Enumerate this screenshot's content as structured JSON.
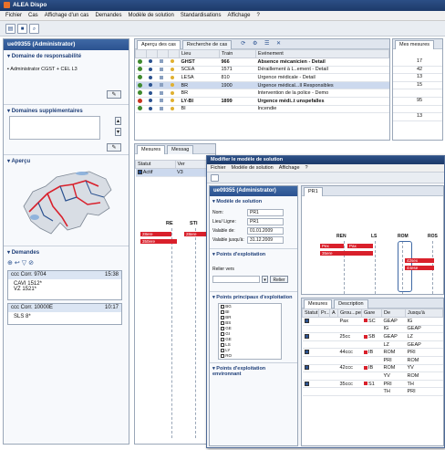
{
  "app": {
    "title": "ALEA Dispo"
  },
  "menu": [
    "Fichier",
    "Cas",
    "Affichage d'un cas",
    "Demandes",
    "Modèle de solution",
    "Standardisations",
    "Affichage",
    "?"
  ],
  "left": {
    "user": "ue09355 (Administrator)",
    "resp_head": "Domaine de responsabilité",
    "resp_item": "Administrator CGST + CEL L3",
    "supp_head": "Domaines supplémentaires",
    "apercu_head": "Aperçu",
    "demandes_head": "Demandes",
    "requests": [
      {
        "code": "ccc",
        "title": "Corr. 9704",
        "time": "15:38",
        "lines": [
          "CAVI 1512*",
          "VZ 1521*"
        ]
      },
      {
        "code": "ccc",
        "title": "Corr. 10000E",
        "time": "10:17",
        "lines": [
          "SLS 8*"
        ]
      }
    ]
  },
  "cases": {
    "tabs": [
      "Aperçu des cas",
      "Recherche de cas"
    ],
    "columns": [
      "",
      "",
      "",
      "",
      "Lieu",
      "Train",
      "Evénement"
    ],
    "rows": [
      {
        "lieu": "GHST",
        "train": "966",
        "event": "Absence mécanicien - Detail",
        "bold": true,
        "sel": false,
        "c": "#3f8a2e"
      },
      {
        "lieu": "SCEA",
        "train": "1571",
        "event": "Déraillement à L..ement - Detail",
        "bold": false,
        "sel": false,
        "c": "#3f8a2e"
      },
      {
        "lieu": "LESA",
        "train": "810",
        "event": "Urgence médicale - Detail",
        "bold": false,
        "sel": false,
        "c": "#3f8a2e"
      },
      {
        "lieu": "BR",
        "train": "1900",
        "event": "Urgence médical...Il Responsibles",
        "bold": false,
        "sel": true,
        "c": "#3f8a2e"
      },
      {
        "lieu": "BR",
        "train": "",
        "event": "Intervention de la police - Demo",
        "bold": false,
        "sel": false,
        "c": "#3f8a2e"
      },
      {
        "lieu": "LY-BI",
        "train": "1899",
        "event": "Urgence médi..t unspefalles",
        "bold": true,
        "sel": false,
        "c": "#c8341f"
      },
      {
        "lieu": "BI",
        "train": "",
        "event": "Incendie",
        "bold": false,
        "sel": false,
        "c": "#3f8a2e"
      }
    ]
  },
  "measures_right": {
    "tab": "Mes mesures",
    "rows": [
      "17",
      "42",
      "13",
      "15",
      "",
      "95",
      "",
      "13"
    ]
  },
  "lower_left": {
    "tabs": [
      "Mesures",
      "Messag"
    ],
    "columns": [
      "Statut",
      "Ver"
    ],
    "row": {
      "status": "Actif",
      "ver": "V3"
    },
    "labels": [
      "RE",
      "STI"
    ],
    "bars": [
      "28ere",
      "28ere",
      "350ere"
    ]
  },
  "modal": {
    "title": "Modifier le modèle de solution",
    "menu": [
      "Fichier",
      "Modèle de solution",
      "Affichage",
      "?"
    ],
    "user": "ue09355 (Administrator)",
    "model_head": "Modèle de solution",
    "fields": [
      {
        "label": "Nom:",
        "value": "PR1"
      },
      {
        "label": "Lieu/ Ligne:",
        "value": "PR1"
      },
      {
        "label": "Valable de:",
        "value": "01.01.2009"
      },
      {
        "label": "Valable jusqu'à:",
        "value": "31.12.2009"
      }
    ],
    "points_head": "Points d'exploitation",
    "relier_label": "Relier vers",
    "select_value": "",
    "relier_btn": "Relier",
    "principal_head": "Points principaux d'exploitation",
    "principal_items": [
      "BG",
      "BI",
      "BR",
      "BS",
      "GE",
      "GI",
      "GE",
      "LS",
      "LY",
      "RO"
    ],
    "env_head": "Points d'exploitation environnant",
    "diagram_tab": "PR1",
    "diagram_labels": [
      "REN",
      "LS",
      "ROM",
      "ROS"
    ],
    "diagram_bars": [
      "Pex",
      "Pax",
      "35ere",
      "42sex",
      "44ese"
    ],
    "measures_tabs": [
      "Mesures",
      "Description"
    ],
    "measures_columns": [
      "Statut",
      "Pr...",
      "A",
      "Grou...pe",
      "Gare",
      "De",
      "Jusqu'à"
    ],
    "measures_rows": [
      {
        "grp": "Pax",
        "gare": "SC",
        "de": "GEAP",
        "ju": "IG"
      },
      {
        "grp": "",
        "gare": "",
        "de": "IG",
        "ju": "GEAP"
      },
      {
        "grp": "25cc",
        "gare": "SB",
        "de": "GEAP",
        "ju": "LZ"
      },
      {
        "grp": "",
        "gare": "",
        "de": "LZ",
        "ju": "GEAP"
      },
      {
        "grp": "44ccc",
        "gare": "IB",
        "de": "ROM",
        "ju": "PRI"
      },
      {
        "grp": "",
        "gare": "",
        "de": "PRI",
        "ju": "ROM"
      },
      {
        "grp": "42ccc",
        "gare": "IB",
        "de": "ROM",
        "ju": "YV"
      },
      {
        "grp": "",
        "gare": "",
        "de": "YV",
        "ju": "ROM"
      },
      {
        "grp": "35ccc",
        "gare": "S1",
        "de": "PRI",
        "ju": "TH"
      },
      {
        "grp": "",
        "gare": "",
        "de": "TH",
        "ju": "PRI"
      }
    ]
  },
  "colors": {
    "accent": "#2b5290",
    "alert": "#d9202b",
    "selected": "#ccd9ee"
  }
}
